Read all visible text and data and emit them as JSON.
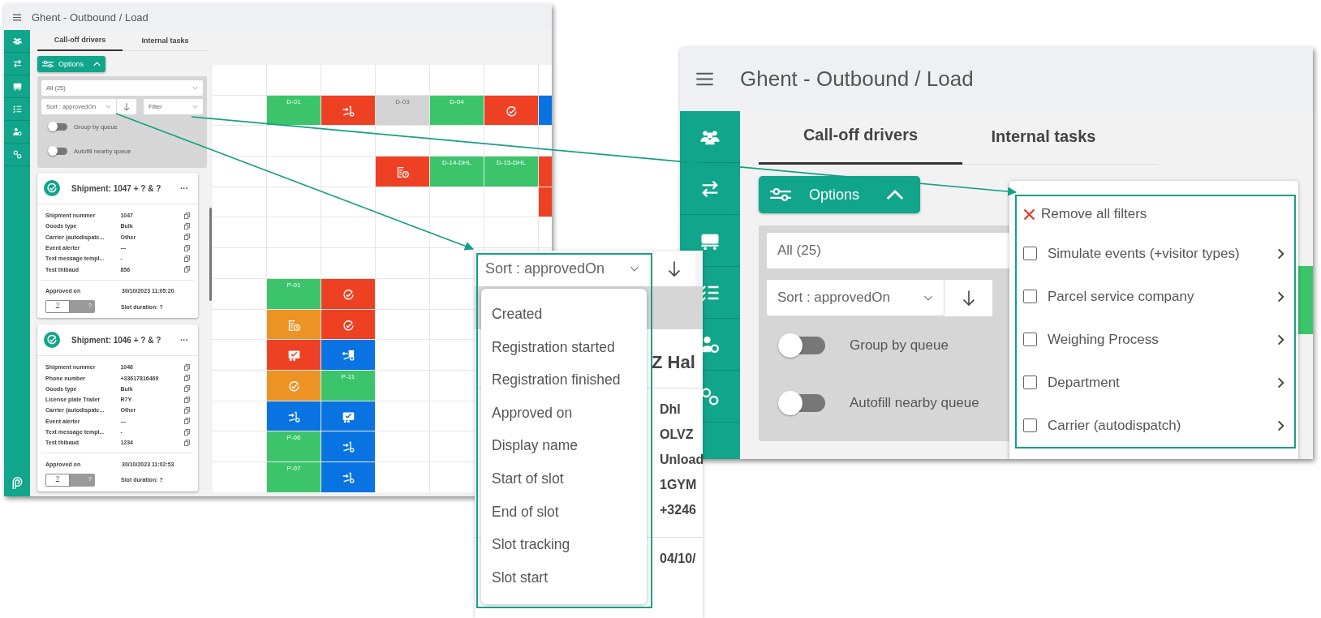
{
  "left_window": {
    "title": "Ghent - Outbound / Load",
    "tabs": [
      {
        "label": "Call-off drivers",
        "selected": true
      },
      {
        "label": "Internal tasks",
        "selected": false
      }
    ],
    "options_button": "Options",
    "queue_select": "All (25)",
    "sort_select": "Sort : approvedOn",
    "filter_select": "Filter",
    "toggles": [
      {
        "label": "Group by queue",
        "on": false
      },
      {
        "label": "Autofill nearby queue",
        "on": false
      }
    ],
    "cards": [
      {
        "title": "Shipment: 1047 + ? & ?",
        "menu": "···",
        "fields": [
          {
            "label": "Shipment nummer",
            "value": "1047"
          },
          {
            "label": "Goods type",
            "value": "Bulk"
          },
          {
            "label": "Carrier (autodispatc...",
            "value": "Other"
          },
          {
            "label": "Event alerter",
            "value": "---"
          },
          {
            "label": "Text message templ...",
            "value": "-"
          },
          {
            "label": "Test thibaud",
            "value": "856"
          }
        ],
        "approved_label": "Approved on",
        "approved_value": "30/10/2023 11:05:20",
        "slot_value": "?",
        "slot_end": "?",
        "slot_duration": "Slot duration: ?"
      },
      {
        "title": "Shipment: 1046 + ? & ?",
        "menu": "···",
        "fields": [
          {
            "label": "Shipment nummer",
            "value": "1046"
          },
          {
            "label": "Phone number",
            "value": "+33617816469"
          },
          {
            "label": "Goods type",
            "value": "Bulk"
          },
          {
            "label": "License plate Trailer",
            "value": "R7Y"
          },
          {
            "label": "Carrier (autodispatc...",
            "value": "Other"
          },
          {
            "label": "Event alerter",
            "value": "---"
          },
          {
            "label": "Text message templ...",
            "value": "-"
          },
          {
            "label": "Test thibaud",
            "value": "1234"
          }
        ],
        "approved_label": "Approved on",
        "approved_value": "30/10/2023 11:02:53",
        "slot_value": "?",
        "slot_end": "?",
        "slot_duration": "Slot duration: ?"
      }
    ],
    "grid": {
      "rows": [
        {
          "cells": [
            {
              "kind": "empty"
            },
            {
              "kind": "empty"
            },
            {
              "kind": "empty"
            },
            {
              "kind": "empty"
            },
            {
              "kind": "empty"
            },
            {
              "kind": "empty"
            },
            {
              "kind": "empty"
            }
          ]
        },
        {
          "cells": [
            {
              "kind": "empty"
            },
            {
              "kind": "label",
              "label": "D-01",
              "color": "#3cc46b"
            },
            {
              "kind": "load",
              "color": "#ee4023"
            },
            {
              "kind": "label",
              "label": "D-03",
              "color": "#d4d4d4"
            },
            {
              "kind": "label",
              "label": "D-04",
              "color": "#3cc46b"
            },
            {
              "kind": "approved",
              "color": "#ee4023"
            },
            {
              "kind": "blank",
              "color": "#0873e1"
            }
          ]
        },
        {
          "cells": [
            {
              "kind": "empty"
            },
            {
              "kind": "empty"
            },
            {
              "kind": "empty"
            },
            {
              "kind": "empty"
            },
            {
              "kind": "empty"
            },
            {
              "kind": "empty"
            },
            {
              "kind": "empty"
            }
          ]
        },
        {
          "cells": [
            {
              "kind": "empty"
            },
            {
              "kind": "empty"
            },
            {
              "kind": "empty"
            },
            {
              "kind": "document-clock",
              "color": "#ee4023"
            },
            {
              "kind": "label",
              "label": "D-14-DHL",
              "color": "#3cc46b"
            },
            {
              "kind": "label",
              "label": "D-15-DHL",
              "color": "#3cc46b"
            },
            {
              "kind": "blank",
              "color": "#ee4023"
            }
          ]
        },
        {
          "cells": [
            {
              "kind": "empty"
            },
            {
              "kind": "empty"
            },
            {
              "kind": "empty"
            },
            {
              "kind": "empty"
            },
            {
              "kind": "empty"
            },
            {
              "kind": "empty"
            },
            {
              "kind": "blank",
              "color": "#ee4023"
            }
          ]
        },
        {
          "cells": [
            {
              "kind": "empty"
            },
            {
              "kind": "empty"
            },
            {
              "kind": "empty"
            },
            {
              "kind": "empty"
            },
            {
              "kind": "empty"
            },
            {
              "kind": "empty"
            },
            {
              "kind": "empty"
            }
          ]
        },
        {
          "cells": [
            {
              "kind": "empty"
            },
            {
              "kind": "empty"
            },
            {
              "kind": "empty"
            },
            {
              "kind": "empty"
            },
            {
              "kind": "empty"
            },
            {
              "kind": "empty"
            },
            {
              "kind": "empty"
            }
          ]
        },
        {
          "cells": [
            {
              "kind": "empty"
            },
            {
              "kind": "label",
              "label": "P-01",
              "color": "#3cc46b"
            },
            {
              "kind": "approved",
              "color": "#ee4023"
            },
            {
              "kind": "empty"
            },
            {
              "kind": "empty"
            }
          ]
        },
        {
          "cells": [
            {
              "kind": "empty"
            },
            {
              "kind": "document-clock",
              "color": "#ec9324"
            },
            {
              "kind": "approved",
              "color": "#ee4023"
            },
            {
              "kind": "empty"
            },
            {
              "kind": "empty"
            }
          ]
        },
        {
          "cells": [
            {
              "kind": "empty"
            },
            {
              "kind": "truck-check",
              "color": "#ee4023"
            },
            {
              "kind": "unload",
              "color": "#0873e1"
            },
            {
              "kind": "empty"
            },
            {
              "kind": "empty"
            },
            {
              "kind": "empty"
            },
            {
              "kind": "empty"
            }
          ]
        },
        {
          "cells": [
            {
              "kind": "empty"
            },
            {
              "kind": "approved",
              "color": "#ec9324"
            },
            {
              "kind": "label",
              "label": "P-11",
              "color": "#3cc46b"
            },
            {
              "kind": "empty"
            },
            {
              "kind": "empty"
            },
            {
              "kind": "empty"
            },
            {
              "kind": "empty"
            }
          ]
        },
        {
          "cells": [
            {
              "kind": "empty"
            },
            {
              "kind": "load",
              "color": "#0873e1"
            },
            {
              "kind": "truck-check",
              "color": "#0873e1"
            },
            {
              "kind": "empty"
            },
            {
              "kind": "empty"
            },
            {
              "kind": "empty"
            },
            {
              "kind": "empty"
            }
          ]
        },
        {
          "cells": [
            {
              "kind": "empty"
            },
            {
              "kind": "label",
              "label": "P-06",
              "color": "#3cc46b"
            },
            {
              "kind": "load",
              "color": "#0873e1"
            },
            {
              "kind": "empty"
            },
            {
              "kind": "empty"
            },
            {
              "kind": "empty"
            },
            {
              "kind": "empty"
            }
          ]
        },
        {
          "cells": [
            {
              "kind": "empty"
            },
            {
              "kind": "label",
              "label": "P-07",
              "color": "#3cc46b"
            },
            {
              "kind": "load",
              "color": "#0873e1"
            },
            {
              "kind": "empty"
            },
            {
              "kind": "empty"
            },
            {
              "kind": "empty"
            },
            {
              "kind": "empty"
            }
          ]
        }
      ]
    }
  },
  "sort_popup": {
    "sort_select": "Sort : approvedOn",
    "options": [
      "Created",
      "Registration started",
      "Registration finished",
      "Approved on",
      "Display name",
      "Start of slot",
      "End of slot",
      "Slot tracking",
      "Slot start"
    ],
    "card_title": "Z Hal",
    "card_values": [
      "Dhl",
      "OLVZ",
      "Unload",
      "1GYM",
      "+3246"
    ],
    "card_date": "04/10/"
  },
  "right_window": {
    "title": "Ghent - Outbound / Load",
    "tabs": [
      {
        "label": "Call-off drivers",
        "selected": true
      },
      {
        "label": "Internal tasks",
        "selected": false
      }
    ],
    "options_button": "Options",
    "queue_select": "All (25)",
    "sort_select": "Sort : approvedOn",
    "toggles": [
      {
        "label": "Group by queue",
        "on": false
      },
      {
        "label": "Autofill nearby queue",
        "on": false
      }
    ],
    "filter_menu": {
      "remove_label": "Remove all filters",
      "items": [
        {
          "label": "Simulate events (+visitor types)",
          "checked": false
        },
        {
          "label": "Parcel service company",
          "checked": false
        },
        {
          "label": "Weighing Process",
          "checked": false
        },
        {
          "label": "Department",
          "checked": false
        },
        {
          "label": "Carrier (autodispatch)",
          "checked": false
        }
      ]
    }
  }
}
